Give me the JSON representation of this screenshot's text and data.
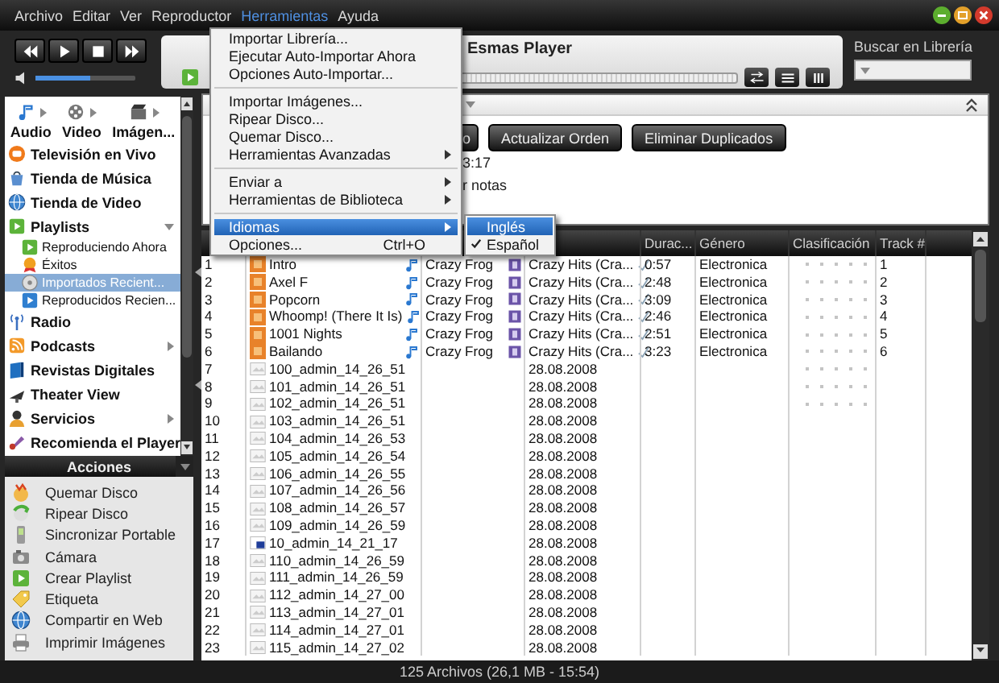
{
  "menu_bar": [
    {
      "label": "Archivo",
      "selected": false
    },
    {
      "label": "Editar",
      "selected": false
    },
    {
      "label": "Ver",
      "selected": false
    },
    {
      "label": "Reproductor",
      "selected": false
    },
    {
      "label": "Herramientas",
      "selected": true
    },
    {
      "label": "Ayuda",
      "selected": false
    }
  ],
  "tools_menu": {
    "items": [
      {
        "kind": "item",
        "label": "Importar Librería...",
        "selected": false
      },
      {
        "kind": "item",
        "label": "Ejecutar Auto-Importar Ahora",
        "selected": false
      },
      {
        "kind": "item",
        "label": "Opciones Auto-Importar...",
        "selected": false
      },
      {
        "kind": "separator"
      },
      {
        "kind": "item",
        "label": "Importar Imágenes...",
        "selected": false
      },
      {
        "kind": "item",
        "label": "Ripear Disco...",
        "selected": false
      },
      {
        "kind": "item",
        "label": "Quemar Disco...",
        "selected": false
      },
      {
        "kind": "submenu",
        "label": "Herramientas Avanzadas",
        "selected": false
      },
      {
        "kind": "separator"
      },
      {
        "kind": "submenu",
        "label": "Enviar a",
        "selected": false
      },
      {
        "kind": "submenu",
        "label": "Herramientas de Biblioteca",
        "selected": false
      },
      {
        "kind": "separator"
      },
      {
        "kind": "submenu",
        "label": "Idiomas",
        "selected": true
      },
      {
        "kind": "item",
        "label": "Opciones...",
        "shortcut": "Ctrl+O",
        "selected": false
      }
    ]
  },
  "language_submenu": [
    {
      "label": "Inglés",
      "selected": true,
      "checked": false
    },
    {
      "label": "Español",
      "selected": false,
      "checked": true
    }
  ],
  "player": {
    "title": "Esmas Player",
    "volume": {
      "level": 0.55
    },
    "progress": {
      "level": 0
    }
  },
  "search": {
    "label": "Buscar en Librería"
  },
  "sidebar": {
    "tabs": [
      {
        "label": "Audio"
      },
      {
        "label": "Video"
      },
      {
        "label": "Imágen..."
      }
    ],
    "items": [
      {
        "label": "Televisión en Vivo",
        "selected": false
      },
      {
        "label": "Tienda de Música",
        "selected": false
      },
      {
        "label": "Tienda de Video",
        "selected": false
      },
      {
        "label": "Playlists",
        "selected": false,
        "expanded": true,
        "children": [
          {
            "label": "Reproduciendo Ahora",
            "selected": false
          },
          {
            "label": "Éxitos",
            "selected": false
          },
          {
            "label": "Importados Recient...",
            "selected": true
          },
          {
            "label": "Reproducidos Recien...",
            "selected": false
          }
        ]
      },
      {
        "label": "Radio",
        "selected": false
      },
      {
        "label": "Podcasts",
        "selected": false,
        "expanded": false
      },
      {
        "label": "Revistas Digitales",
        "selected": false
      },
      {
        "label": "Theater View",
        "selected": false
      },
      {
        "label": "Servicios",
        "selected": false,
        "expanded": false
      },
      {
        "label": "Recomienda el Player",
        "selected": false
      }
    ]
  },
  "actions": {
    "title": "Acciones",
    "items": [
      {
        "label": "Quemar Disco"
      },
      {
        "label": "Ripear Disco"
      },
      {
        "label": "Sincronizar Portable"
      },
      {
        "label": "Cámara"
      },
      {
        "label": "Crear Playlist"
      },
      {
        "label": "Etiqueta"
      },
      {
        "label": "Compartir en Web"
      },
      {
        "label": "Imprimir Imágenes"
      }
    ]
  },
  "library": {
    "buttons": [
      {
        "label": "o"
      },
      {
        "label": "Actualizar Orden"
      },
      {
        "label": "Eliminar Duplicados"
      }
    ],
    "info": [
      "3:17",
      "r notas"
    ]
  },
  "table": {
    "headers": [
      "Durac...",
      "Género",
      "Clasificación",
      "Track #"
    ],
    "rows": [
      {
        "num": "1",
        "kind": "song",
        "title": "Intro",
        "artist": "Crazy Frog",
        "album": "Crazy Hits (Cra...",
        "duration": "0:57",
        "genre": "Electronica",
        "stars": 0,
        "track": "1"
      },
      {
        "num": "2",
        "kind": "song",
        "title": "Axel F",
        "artist": "Crazy Frog",
        "album": "Crazy Hits (Cra...",
        "duration": "2:48",
        "genre": "Electronica",
        "stars": 0,
        "track": "2"
      },
      {
        "num": "3",
        "kind": "song",
        "title": "Popcorn",
        "artist": "Crazy Frog",
        "album": "Crazy Hits (Cra...",
        "duration": "3:09",
        "genre": "Electronica",
        "stars": 0,
        "track": "3"
      },
      {
        "num": "4",
        "kind": "song",
        "title": "Whoomp! (There It Is)",
        "artist": "Crazy Frog",
        "album": "Crazy Hits (Cra...",
        "duration": "2:46",
        "genre": "Electronica",
        "stars": 0,
        "track": "4"
      },
      {
        "num": "5",
        "kind": "song",
        "title": "1001 Nights",
        "artist": "Crazy Frog",
        "album": "Crazy Hits (Cra...",
        "duration": "2:51",
        "genre": "Electronica",
        "stars": 0,
        "track": "5"
      },
      {
        "num": "6",
        "kind": "song",
        "title": "Bailando",
        "artist": "Crazy Frog",
        "album": "Crazy Hits (Cra...",
        "duration": "3:23",
        "genre": "Electronica",
        "stars": 0,
        "track": "6"
      },
      {
        "num": "7",
        "kind": "image",
        "title": "100_admin_14_26_51",
        "album": "28.08.2008",
        "stars": 0
      },
      {
        "num": "8",
        "kind": "image",
        "title": "101_admin_14_26_51",
        "album": "28.08.2008",
        "stars": 0
      },
      {
        "num": "9",
        "kind": "image",
        "title": "102_admin_14_26_51",
        "album": "28.08.2008",
        "stars": 0
      },
      {
        "num": "10",
        "kind": "image",
        "title": "103_admin_14_26_51",
        "album": "28.08.2008"
      },
      {
        "num": "11",
        "kind": "image",
        "title": "104_admin_14_26_53",
        "album": "28.08.2008"
      },
      {
        "num": "12",
        "kind": "image",
        "title": "105_admin_14_26_54",
        "album": "28.08.2008"
      },
      {
        "num": "13",
        "kind": "image",
        "title": "106_admin_14_26_55",
        "album": "28.08.2008"
      },
      {
        "num": "14",
        "kind": "image",
        "title": "107_admin_14_26_56",
        "album": "28.08.2008"
      },
      {
        "num": "15",
        "kind": "image",
        "title": "108_admin_14_26_57",
        "album": "28.08.2008"
      },
      {
        "num": "16",
        "kind": "image",
        "title": "109_admin_14_26_59",
        "album": "28.08.2008"
      },
      {
        "num": "17",
        "kind": "graphic",
        "title": "10_admin_14_21_17",
        "album": "28.08.2008"
      },
      {
        "num": "18",
        "kind": "image",
        "title": "110_admin_14_26_59",
        "album": "28.08.2008"
      },
      {
        "num": "19",
        "kind": "image",
        "title": "111_admin_14_26_59",
        "album": "28.08.2008"
      },
      {
        "num": "20",
        "kind": "image",
        "title": "112_admin_14_27_00",
        "album": "28.08.2008"
      },
      {
        "num": "21",
        "kind": "image",
        "title": "113_admin_14_27_01",
        "album": "28.08.2008"
      },
      {
        "num": "22",
        "kind": "image",
        "title": "114_admin_14_27_01",
        "album": "28.08.2008"
      },
      {
        "num": "23",
        "kind": "image",
        "title": "115_admin_14_27_02",
        "album": "28.08.2008"
      }
    ]
  },
  "status_bar": {
    "text": "125 Archivos (26,1 MB - 15:54)"
  }
}
